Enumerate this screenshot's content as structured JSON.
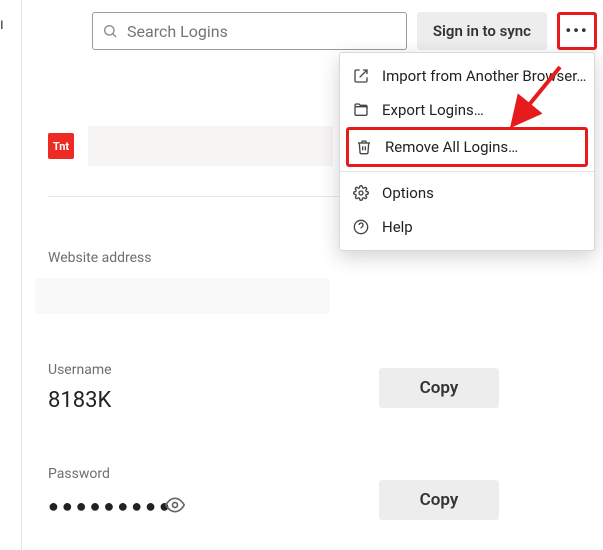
{
  "header": {
    "search_placeholder": "Search Logins",
    "sync_label": "Sign in to sync"
  },
  "menu": {
    "items": [
      {
        "label": "Import from Another Browser…"
      },
      {
        "label": "Export Logins…"
      },
      {
        "label": "Remove All Logins…"
      },
      {
        "label": "Options"
      },
      {
        "label": "Help"
      }
    ]
  },
  "login": {
    "favicon_text": "Tnt",
    "website_label": "Website address",
    "username_label": "Username",
    "username_value": "8183K",
    "password_label": "Password",
    "password_masked": "●●●●●●●●●",
    "copy_label": "Copy"
  }
}
